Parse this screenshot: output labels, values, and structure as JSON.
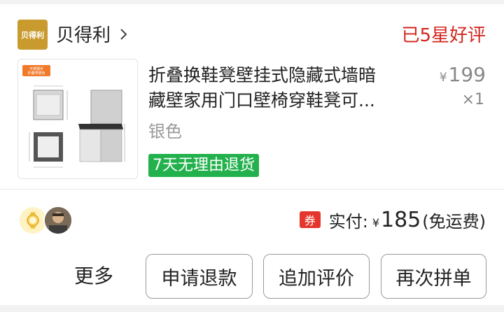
{
  "shop": {
    "logo_text": "贝得利",
    "name": "贝得利"
  },
  "order": {
    "status": "已5星好评"
  },
  "product": {
    "title_line1": "折叠换鞋凳壁挂式隐藏式墙暗",
    "title_line2": "藏壁家用门口壁椅穿鞋凳可...",
    "price_symbol": "¥",
    "price": "199",
    "quantity": "×1",
    "variant": "银色",
    "return_badge": "7天无理由退货",
    "thumb_tag_line1": "不锈钢手",
    "thumb_tag_line2": "折叠凳银色"
  },
  "payment": {
    "coupon_label": "券",
    "label": "实付:",
    "currency": "¥",
    "amount": "185",
    "note": "(免运费)"
  },
  "actions": {
    "more": "更多",
    "refund": "申请退款",
    "add_review": "追加评价",
    "rebuy": "再次拼单"
  },
  "colors": {
    "status": "#d2261d",
    "badge": "#23b14d",
    "coupon": "#e4362c",
    "logo": "#c99a2e"
  }
}
